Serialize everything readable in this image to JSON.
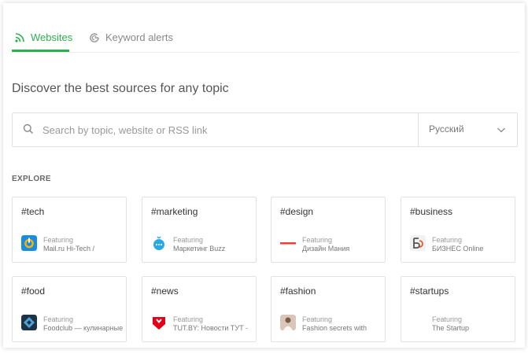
{
  "tabs": [
    {
      "label": "Websites",
      "icon": "rss-icon",
      "active": true
    },
    {
      "label": "Keyword alerts",
      "icon": "google-icon",
      "active": false
    }
  ],
  "heading": "Discover the best sources for any topic",
  "search": {
    "placeholder": "Search by topic, website or RSS link",
    "value": ""
  },
  "language": {
    "selected": "Русский"
  },
  "explore_label": "EXPLORE",
  "featuring_label": "Featuring",
  "cards": [
    {
      "tag": "#tech",
      "source": "Mail.ru Hi-Tech /"
    },
    {
      "tag": "#marketing",
      "source": "Маркетинг Buzz"
    },
    {
      "tag": "#design",
      "source": "Дизайн Мания"
    },
    {
      "tag": "#business",
      "source": "БИЗНЕС Online"
    },
    {
      "tag": "#food",
      "source": "Foodclub — кулинарные"
    },
    {
      "tag": "#news",
      "source": "TUT.BY: Новости ТУТ -"
    },
    {
      "tag": "#fashion",
      "source": "Fashion secrets with"
    },
    {
      "tag": "#startups",
      "source": "The Startup"
    }
  ],
  "colors": {
    "accent": "#2bb24c",
    "border": "#e2e2e2",
    "text": "#333333",
    "muted": "#999999"
  }
}
